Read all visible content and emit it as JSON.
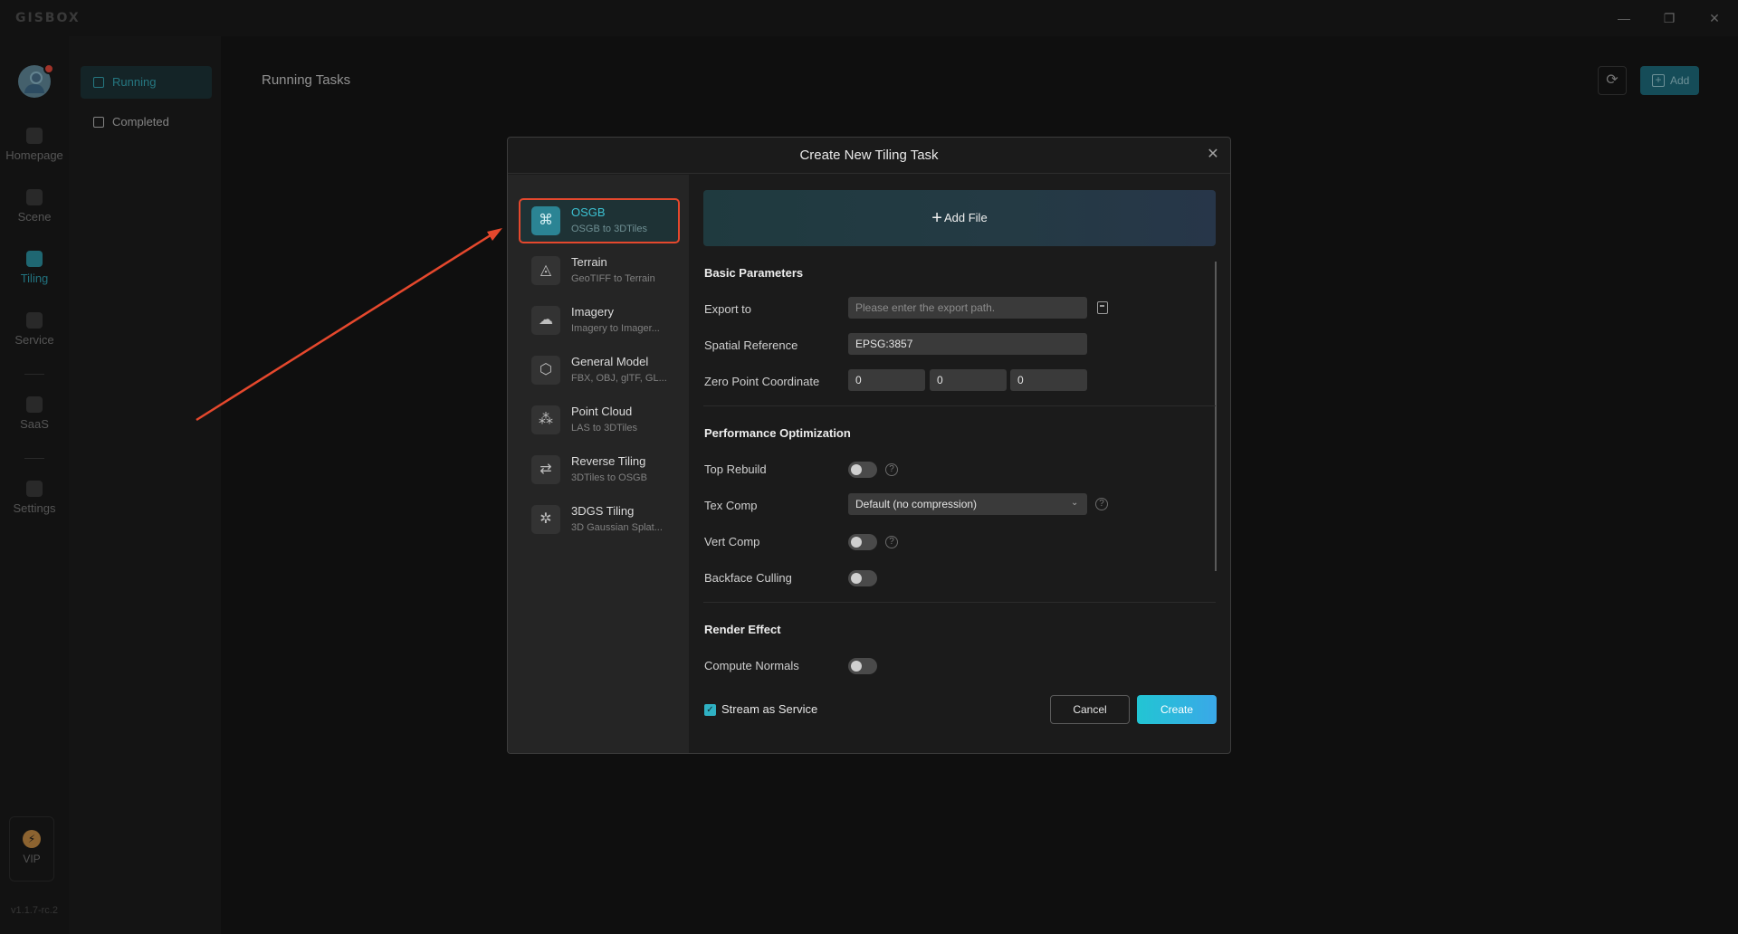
{
  "app": {
    "logo": "GISBOX",
    "version": "v1.1.7-rc.2",
    "window_controls": {
      "minimize": "—",
      "restore": "❐",
      "close": "✕"
    }
  },
  "rail": {
    "items": [
      {
        "label": "Homepage",
        "icon": "home-icon"
      },
      {
        "label": "Scene",
        "icon": "cube-icon"
      },
      {
        "label": "Tiling",
        "icon": "tiling-icon",
        "active": true
      },
      {
        "label": "Service",
        "icon": "service-icon"
      },
      {
        "label": "SaaS",
        "icon": "cloud-lock-icon"
      },
      {
        "label": "Settings",
        "icon": "gear-icon"
      }
    ],
    "vip": {
      "label": "VIP",
      "icon": "bolt-icon",
      "glyph": "⚡"
    }
  },
  "subnav": {
    "items": [
      {
        "label": "Running",
        "active": true
      },
      {
        "label": "Completed"
      }
    ]
  },
  "main": {
    "title": "Running Tasks",
    "add_label": "Add",
    "refresh_glyph": "⟳"
  },
  "modal": {
    "title": "Create New Tiling Task",
    "close_glyph": "✕",
    "types": [
      {
        "name": "OSGB",
        "desc": "OSGB to 3DTiles",
        "glyph": "⌘",
        "selected": true
      },
      {
        "name": "Terrain",
        "desc": "GeoTIFF to Terrain",
        "glyph": "◬"
      },
      {
        "name": "Imagery",
        "desc": "Imagery to Imager...",
        "glyph": "☁"
      },
      {
        "name": "General Model",
        "desc": "FBX, OBJ, glTF, GL...",
        "glyph": "⬡"
      },
      {
        "name": "Point Cloud",
        "desc": "LAS to 3DTiles",
        "glyph": "⁂"
      },
      {
        "name": "Reverse Tiling",
        "desc": "3DTiles to OSGB",
        "glyph": "⇄"
      },
      {
        "name": "3DGS Tiling",
        "desc": "3D Gaussian Splat...",
        "glyph": "✲"
      }
    ],
    "add_file_label": "Add File",
    "add_file_plus": "+",
    "basic_parameters": {
      "heading": "Basic Parameters",
      "export_label": "Export to",
      "export_placeholder": "Please enter the export path.",
      "spatial_ref_label": "Spatial Reference",
      "spatial_ref_value": "EPSG:3857",
      "zero_point_label": "Zero Point Coordinate",
      "zero_point_values": [
        "0",
        "0",
        "0"
      ]
    },
    "performance": {
      "heading": "Performance Optimization",
      "top_rebuild_label": "Top Rebuild",
      "top_rebuild_on": false,
      "tex_comp_label": "Tex Comp",
      "tex_comp_value": "Default (no compression)",
      "vert_comp_label": "Vert Comp",
      "vert_comp_on": false,
      "backface_label": "Backface Culling",
      "backface_on": false
    },
    "render": {
      "heading": "Render Effect",
      "compute_normals_label": "Compute Normals",
      "compute_normals_on": false
    },
    "stream_label": "Stream as Service",
    "stream_checked": true,
    "check_glyph": "✓",
    "help_glyph": "?",
    "caret_glyph": "⌄",
    "cancel_label": "Cancel",
    "create_label": "Create"
  },
  "colors": {
    "accent": "#2fb1c3",
    "annotation": "#e5482d",
    "background": "#151515",
    "modal_bg": "#1b1b1b"
  }
}
